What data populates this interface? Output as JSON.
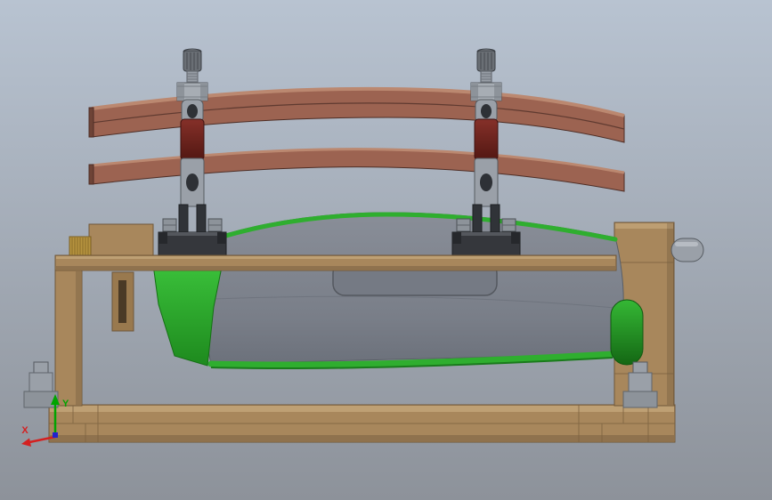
{
  "triad": {
    "x_label": "X",
    "y_label": "Y"
  },
  "colors": {
    "bg-top": "#b8c3d1",
    "bg-bottom": "#8d929a",
    "wood": "#a8875c",
    "wood-light": "#c2a478",
    "wood-edge": "#6f5739",
    "wood-slot": "#4a3a26",
    "copper": "#9c6351",
    "copper-light": "#bb8870",
    "copper-dark": "#4e2e26",
    "part-gray": "#7d828c",
    "part-gray-dark": "#686d77",
    "pocket-gray": "#757a84",
    "green": "#2fae2f",
    "green-dark": "#1a7a1c",
    "metal": "#9aa0a8",
    "metal-mid": "#8d939a",
    "metal-dark": "#565b61",
    "maroon": "#762824",
    "black-part": "#2f3136",
    "black-edge": "#1e2023",
    "brass": "#b6933f",
    "axis-red": "#d42020",
    "axis-green": "#00a400",
    "axis-blue": "#2222cc"
  }
}
